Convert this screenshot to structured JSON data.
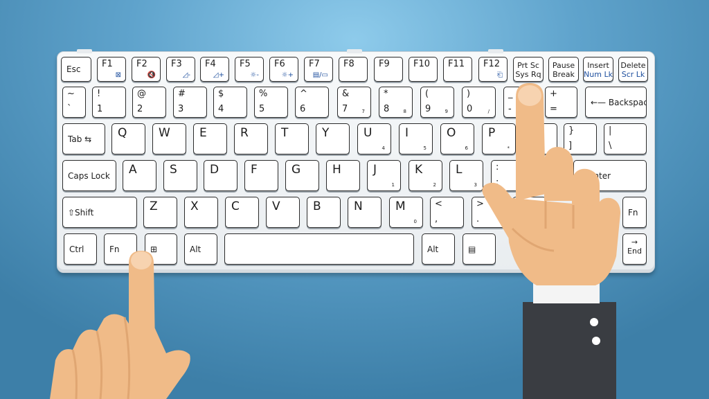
{
  "colors": {
    "background": "#5fa3cc",
    "keyboard": "#f4f6f8",
    "key_border": "#2a2a2a",
    "fn_legend": "#1e4f9e",
    "skin": "#f0bb88",
    "sleeve": "#3a3d42",
    "cuff": "#ffffff"
  },
  "rows": [
    [
      {
        "c": "Esc"
      },
      {
        "t": "F1",
        "f": "⊠"
      },
      {
        "t": "F2",
        "f": "🔇"
      },
      {
        "t": "F3",
        "f": "◿-"
      },
      {
        "t": "F4",
        "f": "◿+"
      },
      {
        "t": "F5",
        "f": "☼-"
      },
      {
        "t": "F6",
        "f": "☼+"
      },
      {
        "t": "F7",
        "f": "▤/▭"
      },
      {
        "t": "F8"
      },
      {
        "t": "F9"
      },
      {
        "t": "F10"
      },
      {
        "t": "F11"
      },
      {
        "t": "F12",
        "f": "⎗"
      },
      {
        "l1": "Prt Sc",
        "l2": "Sys Rq"
      },
      {
        "l1": "Pause",
        "l2": "Break"
      },
      {
        "l1": "Insert",
        "l2": "Num Lk",
        "blue": true
      },
      {
        "l1": "Delete",
        "l2": "Scr Lk",
        "blue": true
      }
    ],
    [
      {
        "t": "~",
        "b": "`"
      },
      {
        "t": "!",
        "b": "1"
      },
      {
        "t": "@",
        "b": "2"
      },
      {
        "t": "#",
        "b": "3"
      },
      {
        "t": "$",
        "b": "4"
      },
      {
        "t": "%",
        "b": "5"
      },
      {
        "t": "^",
        "b": "6"
      },
      {
        "t": "&",
        "b": "7",
        "n": "7"
      },
      {
        "t": "*",
        "b": "8",
        "n": "8"
      },
      {
        "t": "(",
        "b": "9",
        "n": "9"
      },
      {
        "t": ")",
        "b": "0",
        "n": "/"
      },
      {
        "t": "_",
        "b": "-"
      },
      {
        "t": "+",
        "b": "="
      },
      {
        "c": "←— Backspace"
      }
    ],
    [
      {
        "c": "Tab ⇆"
      },
      {
        "big": "Q"
      },
      {
        "big": "W"
      },
      {
        "big": "E"
      },
      {
        "big": "R"
      },
      {
        "big": "T"
      },
      {
        "big": "Y"
      },
      {
        "big": "U",
        "n": "4"
      },
      {
        "big": "I",
        "n": "5"
      },
      {
        "big": "O",
        "n": "6"
      },
      {
        "big": "P",
        "n": "*"
      },
      {
        "t": "{",
        "b": "["
      },
      {
        "t": "}",
        "b": "]"
      },
      {
        "t": "|",
        "b": "\\"
      }
    ],
    [
      {
        "c": "Caps Lock"
      },
      {
        "big": "A"
      },
      {
        "big": "S"
      },
      {
        "big": "D"
      },
      {
        "big": "F"
      },
      {
        "big": "G"
      },
      {
        "big": "H"
      },
      {
        "big": "J",
        "n": "1"
      },
      {
        "big": "K",
        "n": "2"
      },
      {
        "big": "L",
        "n": "3"
      },
      {
        "t": ":",
        "b": ";"
      },
      {
        "t": "\"",
        "b": "'"
      },
      {
        "c": "        ⌐ Enter"
      }
    ],
    [
      {
        "c": "⇧Shift"
      },
      {
        "big": "Z"
      },
      {
        "big": "X"
      },
      {
        "big": "C"
      },
      {
        "big": "V"
      },
      {
        "big": "B"
      },
      {
        "big": "N"
      },
      {
        "big": "M",
        "n": "0"
      },
      {
        "t": "<",
        "b": ","
      },
      {
        "t": ">",
        "b": "."
      },
      {
        "t": "?",
        "b": "/"
      },
      {
        "c": "Fn"
      }
    ],
    [
      {
        "c": "Ctrl"
      },
      {
        "c": "Fn"
      },
      {
        "c": "⊞",
        "icon": "windows-icon"
      },
      {
        "c": "Alt"
      },
      {
        "c": ""
      },
      {
        "c": "Alt"
      },
      {
        "c": "▤",
        "icon": "menu-icon"
      },
      {
        "l1": "→",
        "l2": "End"
      }
    ]
  ]
}
